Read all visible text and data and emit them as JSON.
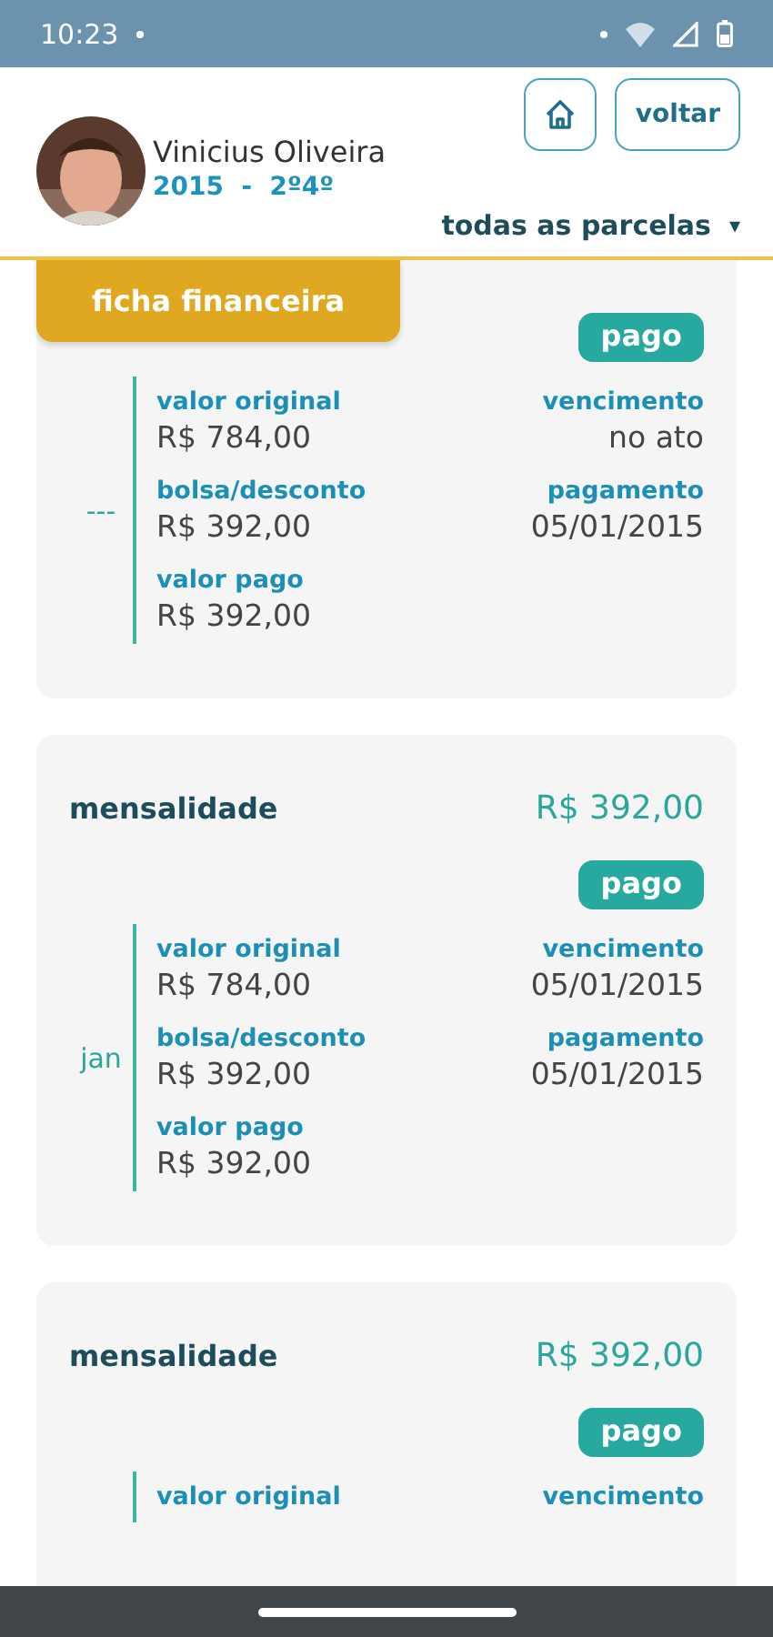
{
  "status_bar": {
    "time": "10:23"
  },
  "header": {
    "name": "Vinicius Oliveira",
    "year": "2015",
    "separator": "-",
    "class": "2º4º",
    "back_button": "voltar",
    "filter": "todas as parcelas",
    "filter_caret": "▾"
  },
  "tab": {
    "label": "ficha financeira"
  },
  "cards": [
    {
      "month": "---",
      "status": "pago",
      "left": [
        {
          "label": "valor original",
          "value": "R$ 784,00"
        },
        {
          "label": "bolsa/desconto",
          "value": "R$ 392,00"
        },
        {
          "label": "valor pago",
          "value": "R$ 392,00"
        }
      ],
      "right": [
        {
          "label": "vencimento",
          "value": "no ato"
        },
        {
          "label": "pagamento",
          "value": "05/01/2015"
        }
      ]
    },
    {
      "title": "mensalidade",
      "amount": "R$ 392,00",
      "month": "jan",
      "status": "pago",
      "left": [
        {
          "label": "valor original",
          "value": "R$ 784,00"
        },
        {
          "label": "bolsa/desconto",
          "value": "R$ 392,00"
        },
        {
          "label": "valor pago",
          "value": "R$ 392,00"
        }
      ],
      "right": [
        {
          "label": "vencimento",
          "value": "05/01/2015"
        },
        {
          "label": "pagamento",
          "value": "05/01/2015"
        }
      ]
    },
    {
      "title": "mensalidade",
      "amount": "R$ 392,00",
      "status": "pago",
      "left": [
        {
          "label": "valor original"
        }
      ],
      "right": [
        {
          "label": "vencimento"
        }
      ]
    }
  ]
}
